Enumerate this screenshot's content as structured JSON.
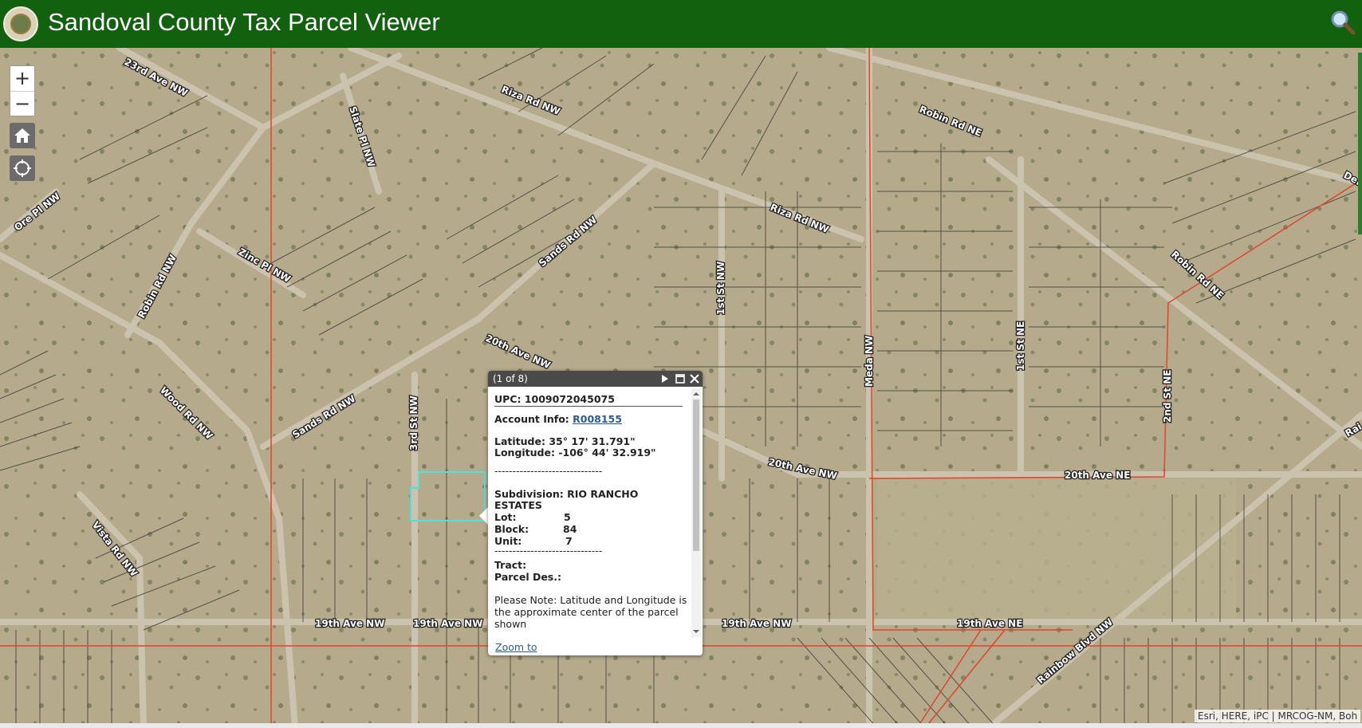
{
  "header": {
    "title": "Sandoval County Tax Parcel Viewer",
    "seal_icon": "county-seal-icon",
    "search_icon": "search-icon",
    "bg_color": "#12610f"
  },
  "map": {
    "zoom_in_label": "+",
    "zoom_out_label": "−",
    "home_icon": "home-icon",
    "locate_icon": "locate-icon",
    "street_labels": [
      "23rd Ave NW",
      "Riza Rd NW",
      "Slate Pl NW",
      "Robin Rd NE",
      "Ore Pl NW",
      "Zinc Pl NW",
      "Sands Rd NW",
      "Riza Rd NW",
      "Robin Rd NW",
      "Robin Rd NE",
      "1st St NW",
      "Meda NW",
      "1st St NE",
      "20th Ave NW",
      "3rd St NW",
      "Wood Rd NW",
      "Sands Rd NW",
      "20th Ave NW",
      "20th Ave NE",
      "2nd St NE",
      "Vista Rd NW",
      "19th Ave NW",
      "19th Ave NW",
      "19th Ave NW",
      "19th Ave NE",
      "Rainbow Blvd NW",
      "Del",
      "Rai"
    ],
    "attribution": "Esri, HERE, iPC | MRCOG-NM, Boh"
  },
  "popup": {
    "count": "(1 of 8)",
    "upc_label": "UPC:",
    "upc_value": "1009072045075",
    "account_label": "Account Info:",
    "account_value": "R008155",
    "latitude_label": "Latitude:",
    "latitude_value": "35° 17' 31.791\"",
    "longitude_label": "Longitude:",
    "longitude_value": "-106° 44' 32.919\"",
    "dashes": "------------------------------",
    "subdivision_label": "Subdivision:",
    "subdivision_line1": "RIO RANCHO",
    "subdivision_line2": "ESTATES",
    "lot_label": "Lot:",
    "lot_value": "5",
    "block_label": "Block:",
    "block_value": "84",
    "unit_label": "Unit:",
    "unit_value": "7",
    "tract_label": "Tract:",
    "parcel_des_label": "Parcel Des.:",
    "note_line1": "Please Note: Latitude and Longitude is",
    "note_line2": "the approximate center of the parcel",
    "note_line3": "shown",
    "zoom_to": "Zoom to",
    "next_icon": "next-icon",
    "maximize_icon": "maximize-icon",
    "close_icon": "close-icon"
  },
  "colors": {
    "selected_parcel": "#4fe0e0",
    "boundary_red": "#e0452a",
    "parcel_line": "#3a3a34",
    "road": "#cbc3ad"
  }
}
